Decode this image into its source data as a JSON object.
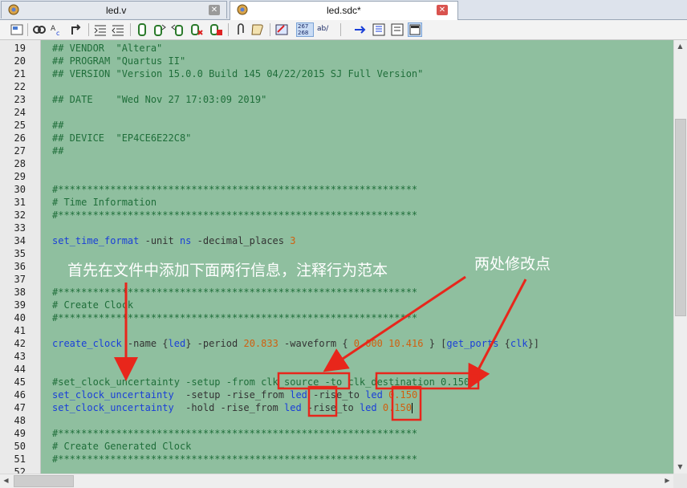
{
  "tabs": [
    {
      "label": "led.v",
      "active": false,
      "close": "✕"
    },
    {
      "label": "led.sdc*",
      "active": true,
      "close": "✕"
    }
  ],
  "toolbar": {
    "icons": [
      "page-setup-icon",
      "find-icon",
      "find-replace-icon",
      "goto-icon",
      "indent-icon",
      "unindent-icon",
      "bookmark-icon",
      "bookmark-next-icon",
      "bookmark-prev-icon",
      "bookmark-clear-icon",
      "bookmark-delete-icon",
      "attach-icon",
      "script-icon",
      "insert-template-icon",
      "line-numbers-icon",
      "word-wrap-icon",
      "goto-line-icon",
      "select-column-icon",
      "block-comment-icon"
    ],
    "line_numbers_label": "267\n268",
    "ab_label": "ab/"
  },
  "colors": {
    "editor_bg": "#8fbf9f",
    "comment": "#1f6e3a",
    "keyword": "#1a3fd8",
    "number": "#d0600f",
    "annotation": "#e8261b"
  },
  "lines": [
    {
      "n": "19",
      "segs": [
        {
          "t": "## VENDOR  \"Altera\"",
          "c": "c"
        }
      ]
    },
    {
      "n": "20",
      "segs": [
        {
          "t": "## PROGRAM \"Quartus II\"",
          "c": "c"
        }
      ]
    },
    {
      "n": "21",
      "segs": [
        {
          "t": "## VERSION \"Version 15.0.0 Build 145 04/22/2015 SJ Full Version\"",
          "c": "c"
        }
      ]
    },
    {
      "n": "22",
      "segs": []
    },
    {
      "n": "23",
      "segs": [
        {
          "t": "## DATE    \"Wed Nov 27 17:03:09 2019\"",
          "c": "c"
        }
      ]
    },
    {
      "n": "24",
      "segs": []
    },
    {
      "n": "25",
      "segs": [
        {
          "t": "##",
          "c": "c"
        }
      ]
    },
    {
      "n": "26",
      "segs": [
        {
          "t": "## DEVICE  \"EP4CE6E22C8\"",
          "c": "c"
        }
      ]
    },
    {
      "n": "27",
      "segs": [
        {
          "t": "##",
          "c": "c"
        }
      ]
    },
    {
      "n": "28",
      "segs": []
    },
    {
      "n": "29",
      "segs": []
    },
    {
      "n": "30",
      "segs": [
        {
          "t": "#**************************************************************",
          "c": "c"
        }
      ]
    },
    {
      "n": "31",
      "segs": [
        {
          "t": "# Time Information",
          "c": "c"
        }
      ]
    },
    {
      "n": "32",
      "segs": [
        {
          "t": "#**************************************************************",
          "c": "c"
        }
      ]
    },
    {
      "n": "33",
      "segs": []
    },
    {
      "n": "34",
      "segs": [
        {
          "t": "set_time_format",
          "c": "k"
        },
        {
          "t": " -unit ",
          "c": "p"
        },
        {
          "t": "ns",
          "c": "k"
        },
        {
          "t": " -decimal_places ",
          "c": "p"
        },
        {
          "t": "3",
          "c": "n"
        }
      ]
    },
    {
      "n": "35",
      "segs": []
    },
    {
      "n": "36",
      "segs": []
    },
    {
      "n": "37",
      "segs": []
    },
    {
      "n": "38",
      "segs": [
        {
          "t": "#**************************************************************",
          "c": "c"
        }
      ]
    },
    {
      "n": "39",
      "segs": [
        {
          "t": "# Create Clock",
          "c": "c"
        }
      ]
    },
    {
      "n": "40",
      "segs": [
        {
          "t": "#**************************************************************",
          "c": "c"
        }
      ]
    },
    {
      "n": "41",
      "segs": []
    },
    {
      "n": "42",
      "segs": [
        {
          "t": "create_clock",
          "c": "k"
        },
        {
          "t": " -name ",
          "c": "p"
        },
        {
          "t": "{",
          "c": "p"
        },
        {
          "t": "led",
          "c": "k"
        },
        {
          "t": "}",
          "c": "p"
        },
        {
          "t": " -period ",
          "c": "p"
        },
        {
          "t": "20.833",
          "c": "n"
        },
        {
          "t": " -waveform ",
          "c": "p"
        },
        {
          "t": "{ ",
          "c": "p"
        },
        {
          "t": "0.000 10.416",
          "c": "n"
        },
        {
          "t": " } ",
          "c": "p"
        },
        {
          "t": "[",
          "c": "p"
        },
        {
          "t": "get_ports",
          "c": "k"
        },
        {
          "t": " {",
          "c": "p"
        },
        {
          "t": "clk",
          "c": "k"
        },
        {
          "t": "}]",
          "c": "p"
        }
      ]
    },
    {
      "n": "43",
      "segs": []
    },
    {
      "n": "44",
      "segs": []
    },
    {
      "n": "45",
      "segs": [
        {
          "t": "#set_clock_uncertainty -setup -from clk_source -to clk_destination 0.150",
          "c": "c"
        }
      ]
    },
    {
      "n": "46",
      "segs": [
        {
          "t": "set_clock_uncertainty",
          "c": "k"
        },
        {
          "t": "  -setup -rise_from ",
          "c": "p"
        },
        {
          "t": "led",
          "c": "k"
        },
        {
          "t": " -rise_to ",
          "c": "p"
        },
        {
          "t": "led",
          "c": "k"
        },
        {
          "t": " ",
          "c": "p"
        },
        {
          "t": "0.150",
          "c": "n"
        }
      ]
    },
    {
      "n": "47",
      "segs": [
        {
          "t": "set_clock_uncertainty",
          "c": "k"
        },
        {
          "t": "  -hold -rise_from ",
          "c": "p"
        },
        {
          "t": "led",
          "c": "k"
        },
        {
          "t": " -rise_to ",
          "c": "p"
        },
        {
          "t": "led",
          "c": "k"
        },
        {
          "t": " ",
          "c": "p"
        },
        {
          "t": "0.150",
          "c": "n"
        },
        {
          "t": "|caret|",
          "c": "caret"
        }
      ]
    },
    {
      "n": "48",
      "segs": []
    },
    {
      "n": "49",
      "segs": [
        {
          "t": "#**************************************************************",
          "c": "c"
        }
      ]
    },
    {
      "n": "50",
      "segs": [
        {
          "t": "# Create Generated Clock",
          "c": "c"
        }
      ]
    },
    {
      "n": "51",
      "segs": [
        {
          "t": "#**************************************************************",
          "c": "c"
        }
      ]
    },
    {
      "n": "52",
      "segs": []
    }
  ],
  "annotations": {
    "note_left": "首先在文件中添加下面两行信息，注释行为范本",
    "note_right": "两处修改点"
  }
}
